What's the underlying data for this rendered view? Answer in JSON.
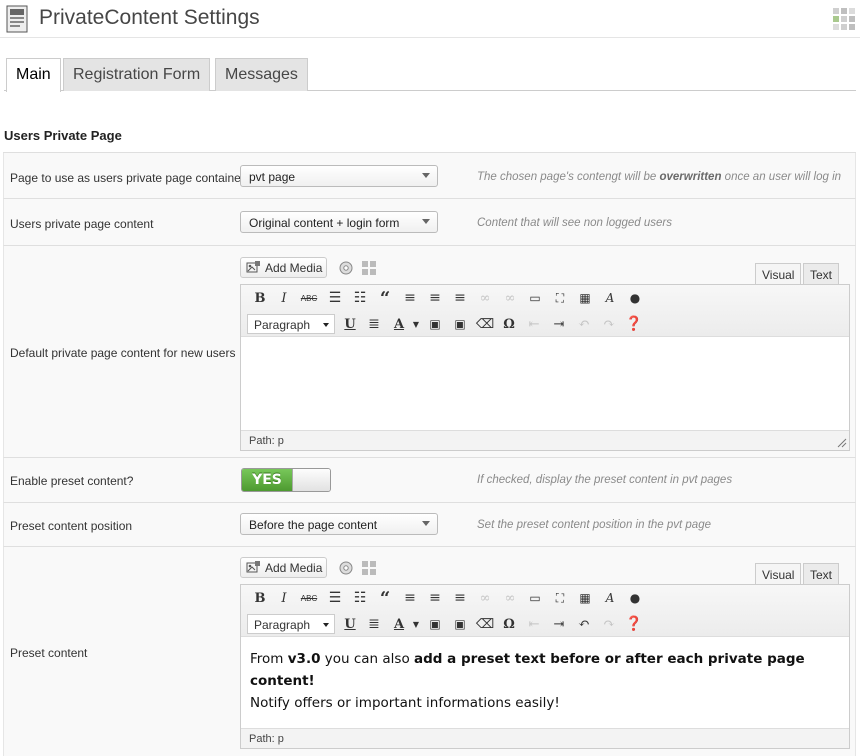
{
  "header": {
    "title": "PrivateContent Settings"
  },
  "tabs": [
    {
      "label": "Main",
      "active": true
    },
    {
      "label": "Registration Form",
      "active": false
    },
    {
      "label": "Messages",
      "active": false
    }
  ],
  "section": {
    "title": "Users Private Page"
  },
  "rows": {
    "container": {
      "label": "Page to use as users private page container",
      "value": "pvt page",
      "hint_pre": "The chosen page's contengt will be ",
      "hint_bold": "overwritten",
      "hint_post": " once an user will log in"
    },
    "content": {
      "label": "Users private page content",
      "value": "Original content + login form",
      "hint": "Content that will see non logged users"
    },
    "default_content": {
      "label": "Default private page content for new users",
      "media_label": "Add Media",
      "visual_label": "Visual",
      "text_label": "Text",
      "format": "Paragraph",
      "path": "Path: p"
    },
    "enable_preset": {
      "label": "Enable preset content?",
      "toggle_label": "YES",
      "hint": "If checked, display the preset content in pvt pages"
    },
    "preset_position": {
      "label": "Preset content position",
      "value": "Before the page content",
      "hint": "Set the preset content position in the pvt page"
    },
    "preset_content": {
      "label": "Preset content",
      "media_label": "Add Media",
      "visual_label": "Visual",
      "text_label": "Text",
      "format": "Paragraph",
      "path": "Path: p",
      "line1_a": "From ",
      "line1_b": "v3.0",
      "line1_c": " you can also ",
      "line1_d": "add a preset text before or after each private page content!",
      "line2": "Notify offers or important informations easily!"
    }
  },
  "colors": {
    "toggle_on": "#5fae40",
    "accent_text": "#464646"
  }
}
